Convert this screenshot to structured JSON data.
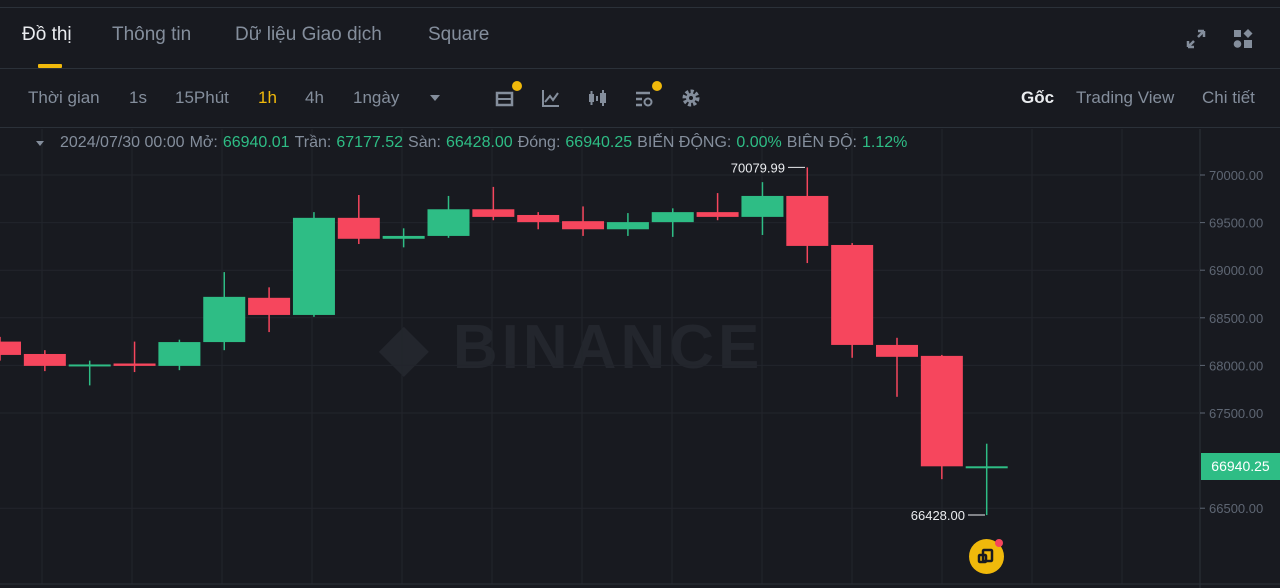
{
  "tabs": [
    {
      "label": "Đồ thị",
      "active": true
    },
    {
      "label": "Thông tin"
    },
    {
      "label": "Dữ liệu Giao dịch"
    },
    {
      "label": "Square"
    }
  ],
  "header_icons": [
    "expand-icon",
    "layout-grid-icon"
  ],
  "toolbar": {
    "time_label": "Thời gian",
    "intervals": [
      "1s",
      "15Phút",
      "1h",
      "4h",
      "1ngày"
    ],
    "active_interval": "1h",
    "tools": [
      "indicator-icon",
      "drawing-icon",
      "candle-type-icon",
      "settings-list-icon",
      "gear-icon"
    ],
    "views": [
      "Gốc",
      "Trading View",
      "Chi tiết"
    ],
    "active_view": "Gốc"
  },
  "info": {
    "datetime": "2024/07/30 00:00",
    "open_label": "Mở:",
    "open": "66940.01",
    "high_label": "Trần:",
    "high": "67177.52",
    "low_label": "Sàn:",
    "low": "66428.00",
    "close_label": "Đóng:",
    "close": "66940.25",
    "change_label": "BIẾN ĐỘNG:",
    "change": "0.00%",
    "amp_label": "BIÊN ĐỘ:",
    "amp": "1.12%"
  },
  "watermark": "BINANCE",
  "colors": {
    "up": "#2ebd85",
    "down": "#f6465d",
    "accent": "#f0b90b",
    "bg": "#181a20"
  },
  "chart_data": {
    "type": "candlestick",
    "yticks": [
      "70000.00",
      "69500.00",
      "69000.00",
      "68500.00",
      "68000.00",
      "67500.00",
      "66500.00"
    ],
    "ylim": [
      66000,
      70500
    ],
    "max_label": "70079.99",
    "min_label": "66428.00",
    "last_price": "66940.25",
    "candles": [
      [
        68250,
        68300,
        68050,
        68110
      ],
      [
        68120,
        68160,
        67940,
        67995
      ],
      [
        67995,
        68050,
        67790,
        68010
      ],
      [
        68020,
        68250,
        67930,
        67995
      ],
      [
        67995,
        68270,
        67950,
        68245
      ],
      [
        68245,
        68980,
        68160,
        68720
      ],
      [
        68710,
        68820,
        68350,
        68530
      ],
      [
        68530,
        69610,
        68510,
        69550
      ],
      [
        69550,
        69790,
        69275,
        69330
      ],
      [
        69330,
        69440,
        69240,
        69360
      ],
      [
        69360,
        69780,
        69340,
        69640
      ],
      [
        69640,
        69875,
        69525,
        69560
      ],
      [
        69580,
        69610,
        69430,
        69505
      ],
      [
        69515,
        69670,
        69360,
        69430
      ],
      [
        69430,
        69600,
        69360,
        69505
      ],
      [
        69505,
        69650,
        69350,
        69610
      ],
      [
        69610,
        69810,
        69525,
        69560
      ],
      [
        69560,
        69925,
        69370,
        69780
      ],
      [
        69780,
        70079.99,
        69075,
        69255
      ],
      [
        69265,
        69285,
        68080,
        68215
      ],
      [
        68215,
        68290,
        67670,
        68090
      ],
      [
        68100,
        68110,
        66805,
        66940
      ],
      [
        66940.01,
        67177.52,
        66428,
        66940.25
      ]
    ]
  }
}
